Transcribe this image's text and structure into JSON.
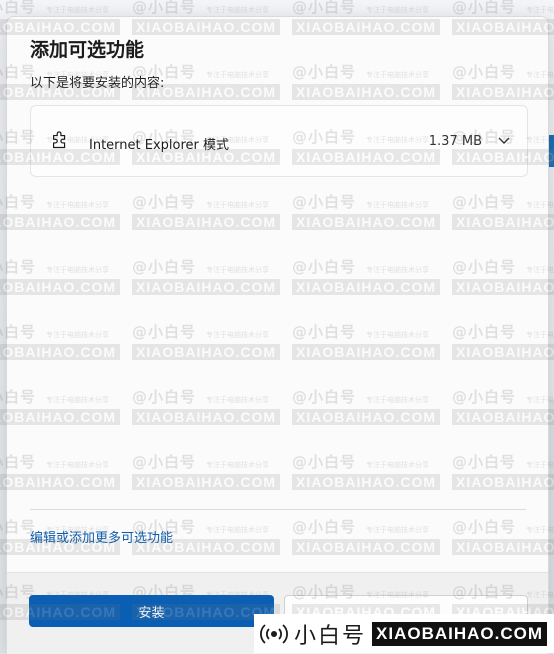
{
  "dialog": {
    "title": "添加可选功能",
    "subtitle": "以下是将要安装的内容:",
    "feature": {
      "name": "Internet Explorer 模式",
      "size": "1.37 MB",
      "icon": "puzzle-piece-icon",
      "expand_icon": "chevron-down-icon"
    },
    "more_link": "编辑或添加更多可选功能",
    "install_label": "安装",
    "cancel_label": ""
  },
  "watermark": {
    "handle": "@小白号",
    "tagline": "专注于电脑技术分享",
    "domain": "XIAOBAIHAO.COM"
  },
  "brand": {
    "name": "小白号",
    "domain": "XIAOBAIHAO.COM",
    "icon": "broadcast-icon"
  },
  "colors": {
    "accent": "#0a5fb4",
    "link": "#0b5cad"
  }
}
